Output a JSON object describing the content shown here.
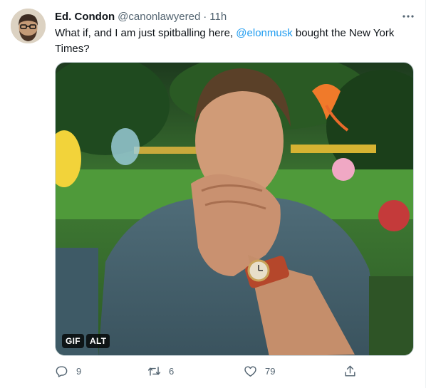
{
  "tweet": {
    "author_name": "Ed. Condon",
    "handle": "@canonlawyered",
    "separator": "·",
    "time": "11h",
    "text_before": "What if, and I am just spitballing here, ",
    "mention": "@elonmusk",
    "text_after": " bought the New York Times?",
    "media": {
      "gif_badge": "GIF",
      "alt_badge": "ALT"
    },
    "actions": {
      "reply_count": "9",
      "retweet_count": "6",
      "like_count": "79"
    }
  },
  "colors": {
    "accent": "#1d9bf0",
    "text": "#0f1419",
    "secondary": "#536471"
  },
  "icons": [
    "more-icon",
    "reply-icon",
    "retweet-icon",
    "like-icon",
    "share-icon"
  ]
}
